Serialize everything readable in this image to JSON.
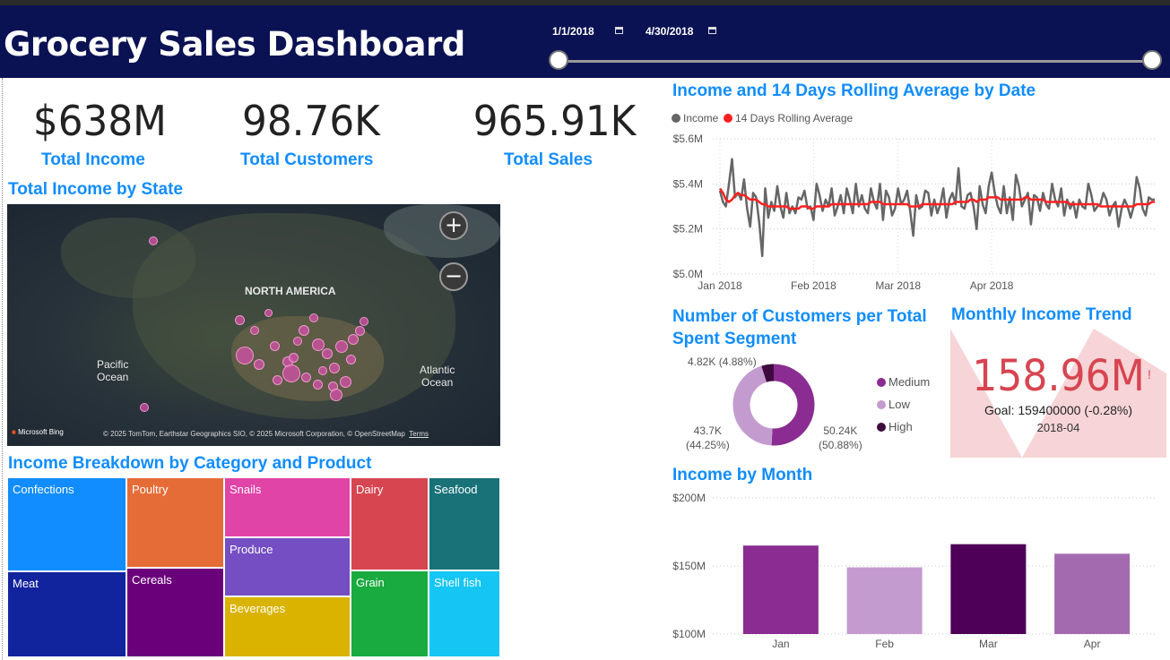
{
  "header": {
    "title": "Grocery Sales Dashboard",
    "start_date": "1/1/2018",
    "end_date": "4/30/2018",
    "background": "#0b1253"
  },
  "kpis": [
    {
      "value": "$638M",
      "label": "Total Income"
    },
    {
      "value": "98.76K",
      "label": "Total Customers"
    },
    {
      "value": "965.91K",
      "label": "Total Sales"
    }
  ],
  "map": {
    "title": "Total Income by State",
    "labels": {
      "continent": "NORTH AMERICA",
      "pacific": "Pacific\nOcean",
      "atlantic": "Atlantic\nOcean"
    },
    "brand": "Microsoft Bing",
    "attribution": "© 2025 TomTom, Earthstar Geographics SIO, © 2025 Microsoft Corporation, © OpenStreetMap",
    "terms": "Terms",
    "zoom_in": "+",
    "zoom_out": "−"
  },
  "treemap": {
    "title": "Income Breakdown by Category and Product",
    "items": [
      {
        "label": "Confections",
        "color": "#118dff"
      },
      {
        "label": "Meat",
        "color": "#12239e"
      },
      {
        "label": "Poultry",
        "color": "#e66c37"
      },
      {
        "label": "Cereals",
        "color": "#6b007b"
      },
      {
        "label": "Snails",
        "color": "#e044a7"
      },
      {
        "label": "Produce",
        "color": "#744ec2"
      },
      {
        "label": "Beverages",
        "color": "#d9b300"
      },
      {
        "label": "Dairy",
        "color": "#d64550"
      },
      {
        "label": "Grain",
        "color": "#1aab40"
      },
      {
        "label": "Seafood",
        "color": "#197278"
      },
      {
        "label": "Shell fish",
        "color": "#15c6f4"
      }
    ]
  },
  "line_title": "Income and 14 Days Rolling Average by Date",
  "donut_title": "Number of Customers per Total Spent Segment",
  "trend": {
    "title": "Monthly Income Trend",
    "value": "158.96M",
    "goal": "Goal: 159400000 (-0.28%)",
    "period": "2018-04",
    "warning": "!"
  },
  "bar_title": "Income by Month",
  "chart_data": [
    {
      "type": "line",
      "title": "Income and 14 Days Rolling Average by Date",
      "series": [
        {
          "name": "Income",
          "color": "#666666",
          "values": [
            5.37,
            5.32,
            5.3,
            5.4,
            5.51,
            5.34,
            5.36,
            5.33,
            5.42,
            5.29,
            5.21,
            5.36,
            5.34,
            5.23,
            5.08,
            5.38,
            5.25,
            5.32,
            5.28,
            5.39,
            5.3,
            5.25,
            5.36,
            5.27,
            5.3,
            5.27,
            5.34,
            5.33,
            5.37,
            5.29,
            5.3,
            5.24,
            5.4,
            5.35,
            5.28,
            5.33,
            5.3,
            5.38,
            5.26,
            5.3,
            5.35,
            5.27,
            5.38,
            5.33,
            5.27,
            5.4,
            5.3,
            5.35,
            5.29,
            5.27,
            5.38,
            5.32,
            5.29,
            5.4,
            5.24,
            5.37,
            5.34,
            5.26,
            5.29,
            5.38,
            5.31,
            5.33,
            5.37,
            5.28,
            5.17,
            5.35,
            5.29,
            5.3,
            5.37,
            5.36,
            5.26,
            5.33,
            5.27,
            5.31,
            5.38,
            5.25,
            5.33,
            5.36,
            5.31,
            5.47,
            5.3,
            5.29,
            5.35,
            5.36,
            5.3,
            5.2,
            5.39,
            5.31,
            5.27,
            5.39,
            5.45,
            5.36,
            5.3,
            5.27,
            5.39,
            5.27,
            5.34,
            5.24,
            5.44,
            5.39,
            5.3,
            5.33,
            5.36,
            5.22,
            5.35,
            5.34,
            5.28,
            5.36,
            5.31,
            5.29,
            5.4,
            5.33,
            5.3,
            5.38,
            5.26,
            5.33,
            5.29,
            5.32,
            5.25,
            5.33,
            5.3,
            5.29,
            5.4,
            5.35,
            5.28,
            5.3,
            5.31,
            5.36,
            5.33,
            5.26,
            5.3,
            5.32,
            5.21,
            5.29,
            5.33,
            5.3,
            5.25,
            5.3,
            5.43,
            5.38,
            5.29,
            5.26,
            5.34,
            5.33,
            5.33
          ]
        },
        {
          "name": "14 Days Rolling Average",
          "color": "#ff2020",
          "values": [
            5.38,
            5.36,
            5.33,
            5.32,
            5.33,
            5.35,
            5.36,
            5.35,
            5.35,
            5.34,
            5.33,
            5.33,
            5.33,
            5.32,
            5.31,
            5.31,
            5.3,
            5.3,
            5.3,
            5.3,
            5.3,
            5.3,
            5.3,
            5.29,
            5.29,
            5.29,
            5.29,
            5.3,
            5.3,
            5.3,
            5.29,
            5.29,
            5.3,
            5.3,
            5.3,
            5.3,
            5.3,
            5.31,
            5.31,
            5.31,
            5.31,
            5.31,
            5.31,
            5.31,
            5.31,
            5.31,
            5.31,
            5.31,
            5.31,
            5.31,
            5.32,
            5.32,
            5.32,
            5.32,
            5.31,
            5.31,
            5.31,
            5.31,
            5.31,
            5.31,
            5.31,
            5.31,
            5.31,
            5.3,
            5.3,
            5.3,
            5.3,
            5.31,
            5.31,
            5.31,
            5.31,
            5.31,
            5.31,
            5.31,
            5.31,
            5.31,
            5.31,
            5.31,
            5.32,
            5.32,
            5.32,
            5.32,
            5.32,
            5.33,
            5.33,
            5.32,
            5.33,
            5.33,
            5.33,
            5.34,
            5.34,
            5.34,
            5.34,
            5.33,
            5.33,
            5.33,
            5.33,
            5.33,
            5.33,
            5.33,
            5.33,
            5.34,
            5.34,
            5.33,
            5.33,
            5.33,
            5.33,
            5.33,
            5.32,
            5.32,
            5.32,
            5.32,
            5.32,
            5.32,
            5.32,
            5.32,
            5.31,
            5.31,
            5.31,
            5.31,
            5.31,
            5.31,
            5.31,
            5.31,
            5.31,
            5.31,
            5.3,
            5.3,
            5.3,
            5.3,
            5.3,
            5.3,
            5.3,
            5.3,
            5.3,
            5.3,
            5.3,
            5.3,
            5.31,
            5.31,
            5.31,
            5.31,
            5.31,
            5.32,
            5.32
          ]
        }
      ],
      "x_ticks": [
        "Jan 2018",
        "Feb 2018",
        "Mar 2018",
        "Apr 2018"
      ],
      "y_ticks": [
        "$5.6M",
        "$5.4M",
        "$5.2M",
        "$5.0M"
      ],
      "ylim": [
        5.0,
        5.6
      ],
      "legend": "top-left",
      "grid": true
    },
    {
      "type": "pie",
      "title": "Number of Customers per Total Spent Segment",
      "slices": [
        {
          "name": "Medium",
          "value": 50.24,
          "display": "50.24K",
          "pct": "(50.88%)",
          "color": "#8a2c91"
        },
        {
          "name": "Low",
          "value": 43.7,
          "display": "43.7K",
          "pct": "(44.25%)",
          "color": "#c49bcf"
        },
        {
          "name": "High",
          "value": 4.82,
          "display": "4.82K (4.88%)",
          "color": "#3e0a3e"
        }
      ]
    },
    {
      "type": "bar",
      "title": "Income by Month",
      "categories": [
        "Jan",
        "Feb",
        "Mar",
        "Apr"
      ],
      "values": [
        165,
        149,
        166,
        159
      ],
      "colors": [
        "#8a2c91",
        "#c49bcf",
        "#4e0058",
        "#a46ab0"
      ],
      "y_ticks": [
        "$200M",
        "$150M",
        "$100M"
      ],
      "ylim": [
        100,
        200
      ]
    }
  ]
}
